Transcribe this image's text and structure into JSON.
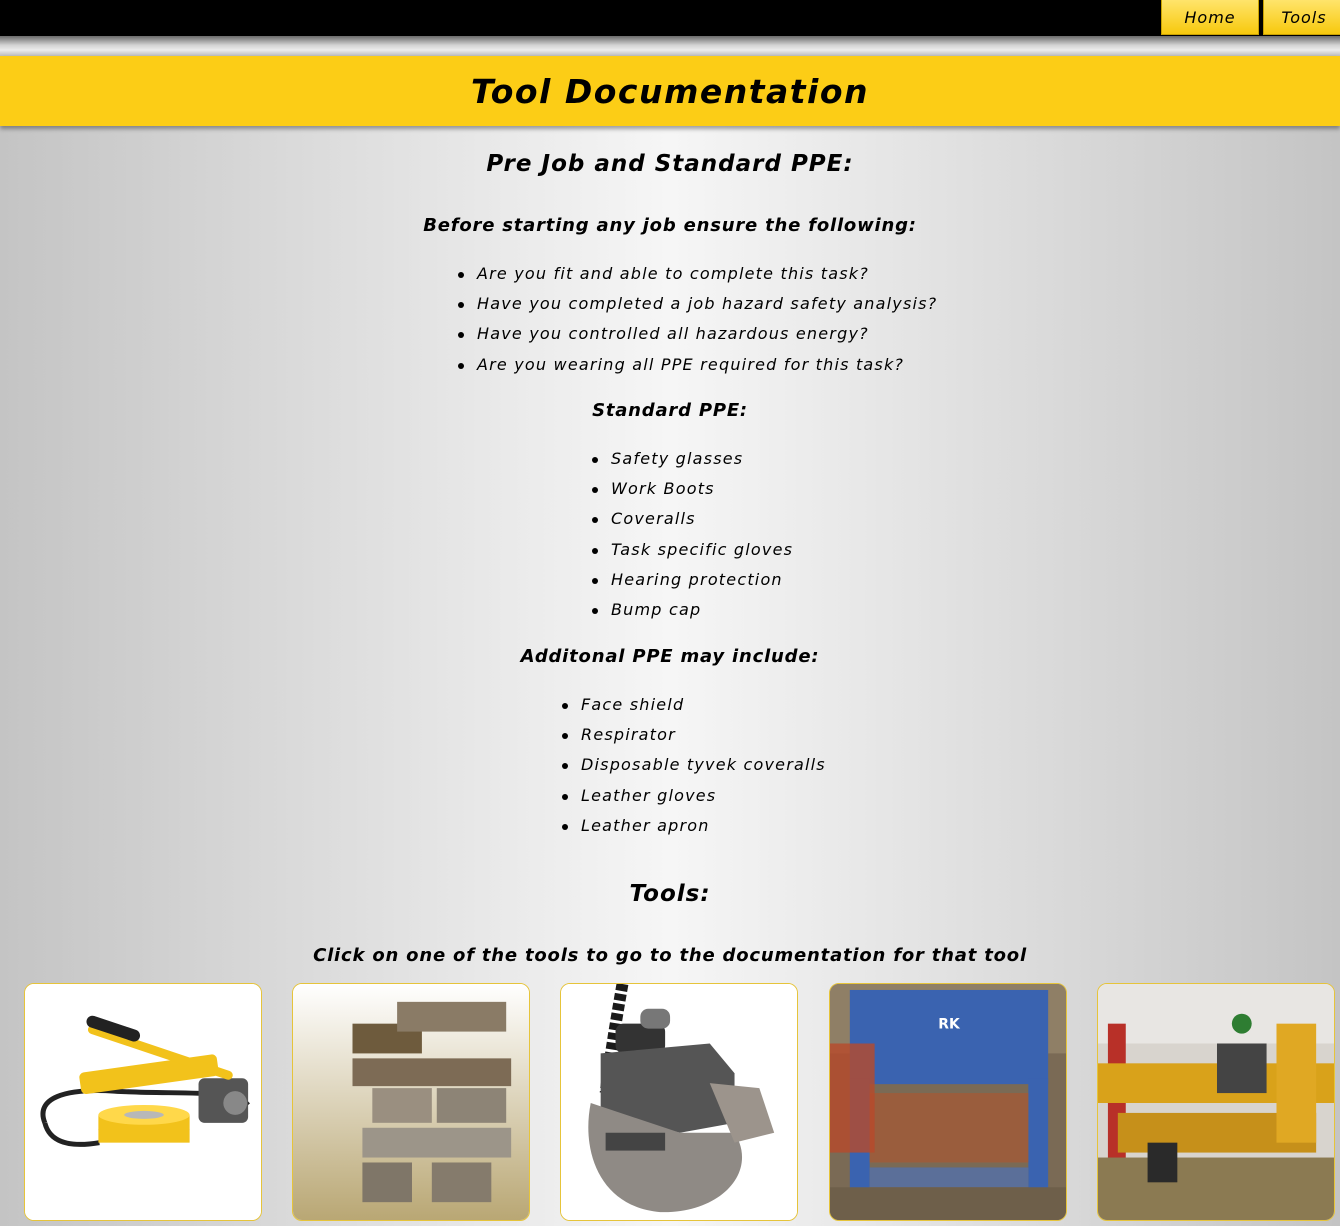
{
  "nav": {
    "home_label": "Home",
    "tools_label": "Tools"
  },
  "banner": {
    "title": "Tool Documentation"
  },
  "section_ppe": {
    "heading": "Pre Job and Standard PPE:",
    "prejob_heading": "Before starting any job ensure the following:",
    "prejob_items": [
      "Are you fit and able to complete this task?",
      "Have you completed a job hazard safety analysis?",
      "Have you controlled all hazardous energy?",
      "Are you wearing all PPE required for this task?"
    ],
    "standard_heading": "Standard PPE:",
    "standard_items": [
      "Safety glasses",
      "Work Boots",
      "Coveralls",
      "Task specific gloves",
      "Hearing protection",
      "Bump cap"
    ],
    "additional_heading": "Additonal PPE may include:",
    "additional_items": [
      "Face shield",
      "Respirator",
      "Disposable tyvek coveralls",
      "Leather gloves",
      "Leather apron"
    ]
  },
  "section_tools": {
    "heading": "Tools:",
    "instruction": "Click on one of the tools to go to the documentation for that tool",
    "tiles": [
      {
        "icon": "hydraulic-pump-jack-image"
      },
      {
        "icon": "cribbing-blocks-image"
      },
      {
        "icon": "hydraulic-torque-wrench-image"
      },
      {
        "icon": "hydraulic-press-image",
        "text": "RK"
      },
      {
        "icon": "industrial-machine-image"
      }
    ]
  },
  "colors": {
    "accent": "#fccd16",
    "topbar": "#000000",
    "tile_border": "#e6c43a"
  }
}
